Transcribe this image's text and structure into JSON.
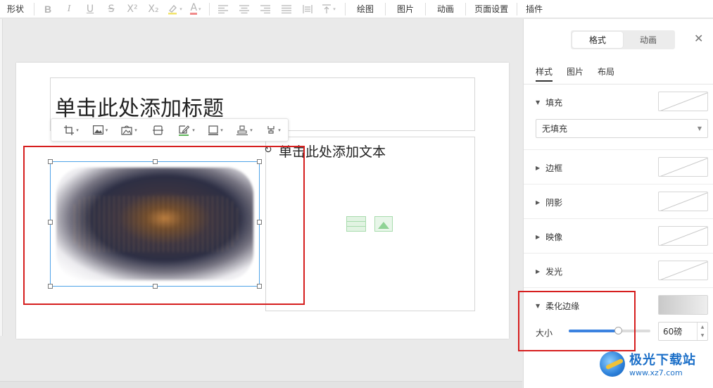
{
  "toolbar": {
    "shape_label": "形状",
    "icons": {
      "bold": "B",
      "italic": "I",
      "underline": "U",
      "strike": "S",
      "superscript": "X²",
      "subscript": "X₂",
      "font_color": "A"
    },
    "menu": [
      "绘图",
      "图片",
      "动画",
      "页面设置",
      "插件"
    ]
  },
  "slide": {
    "title_placeholder": "单击此处添加标题",
    "content_placeholder": "单击此处添加文本"
  },
  "panel": {
    "tabs": [
      "格式",
      "动画"
    ],
    "active_tab": "格式",
    "subtabs": [
      "样式",
      "图片",
      "布局"
    ],
    "active_subtab": "样式",
    "sections": {
      "fill": "填充",
      "fill_value": "无填充",
      "border": "边框",
      "shadow": "阴影",
      "reflection": "映像",
      "glow": "发光",
      "soft_edges": "柔化边缘"
    },
    "size_label": "大小",
    "size_value": "60磅",
    "size_fraction": 0.6
  },
  "colors": {
    "accent": "#3b82e0",
    "highlight_box": "#d61e1e",
    "selection": "#4fa3e8"
  },
  "watermark": {
    "title": "极光下载站",
    "url": "www.xz7.com"
  }
}
